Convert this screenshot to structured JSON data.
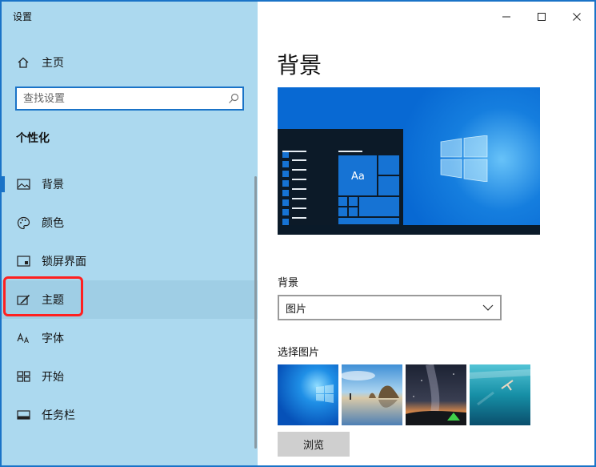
{
  "app": {
    "title": "设置"
  },
  "window_controls": {
    "minimize": "—",
    "maximize": "□",
    "close": "✕"
  },
  "sidebar": {
    "home_label": "主页",
    "search_placeholder": "查找设置",
    "section_title": "个性化",
    "items": [
      {
        "label": "背景",
        "icon": "image-icon",
        "selected": true
      },
      {
        "label": "颜色",
        "icon": "palette-icon"
      },
      {
        "label": "锁屏界面",
        "icon": "lock-screen-icon"
      },
      {
        "label": "主题",
        "icon": "theme-brush-icon"
      },
      {
        "label": "字体",
        "icon": "font-icon"
      },
      {
        "label": "开始",
        "icon": "start-tiles-icon"
      },
      {
        "label": "任务栏",
        "icon": "taskbar-icon"
      }
    ]
  },
  "main": {
    "page_title": "背景",
    "preview": {
      "sample_text": "Aa"
    },
    "background_label": "背景",
    "background_value": "图片",
    "choose_picture_label": "选择图片",
    "thumbnails": [
      "windows-blue-wallpaper",
      "beach-rocks-wallpaper",
      "night-sky-tent-wallpaper",
      "underwater-swimmer-wallpaper"
    ],
    "browse_label": "浏览"
  },
  "colors": {
    "sidebar_bg": "#acd9ef",
    "accent": "#1a73c7",
    "highlight": "#ff2020"
  }
}
